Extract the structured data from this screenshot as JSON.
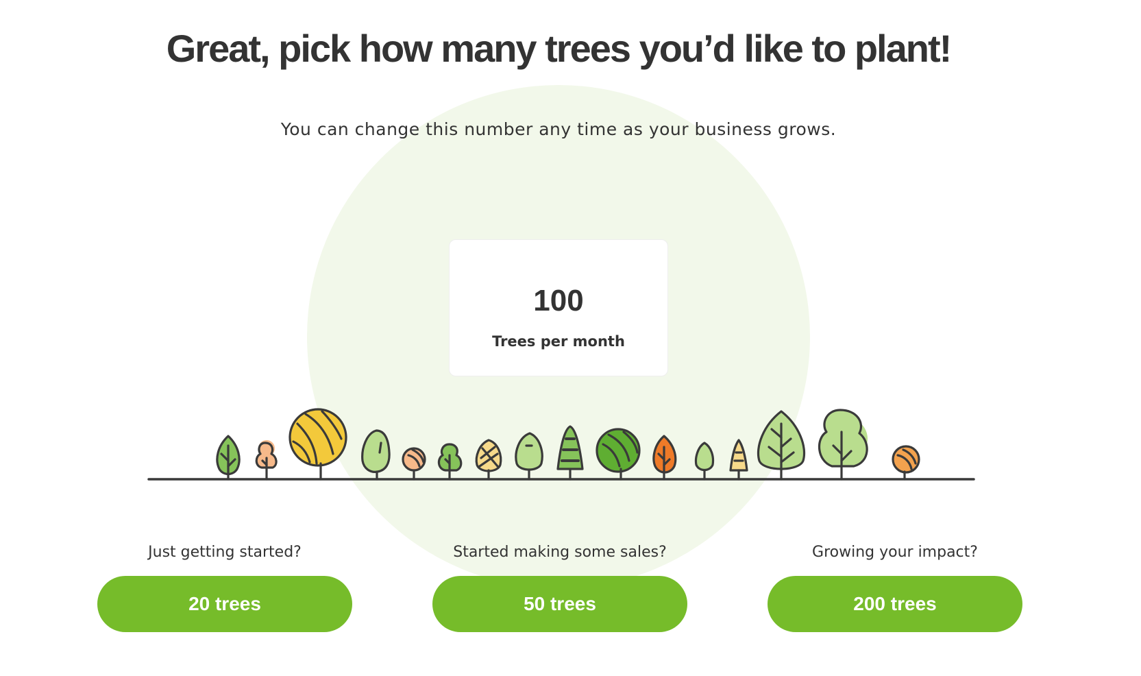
{
  "heading": "Great, pick how many trees you’d like to plant!",
  "subtitle": "You can change this number any time as your business grows.",
  "selection": {
    "value": "100",
    "label": "Trees per month"
  },
  "options": [
    {
      "prompt": "Just getting started?",
      "button_label": "20 trees"
    },
    {
      "prompt": "Started making some sales?",
      "button_label": "50 trees"
    },
    {
      "prompt": "Growing your impact?",
      "button_label": "200 trees"
    }
  ],
  "colors": {
    "accent": "#76bc2a",
    "text": "#333333",
    "circle_background": "#f2f8ea"
  },
  "illustration": "row-of-trees-icon"
}
